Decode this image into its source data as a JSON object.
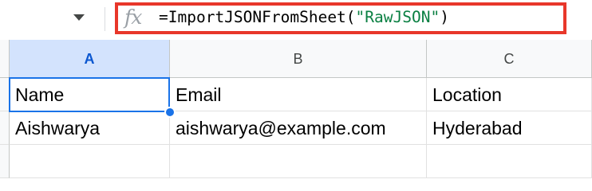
{
  "formula_bar": {
    "fx_label": "fx",
    "formula_prefix": "=ImportJSONFromSheet(",
    "formula_string": "\"RawJSON\"",
    "formula_suffix": ")"
  },
  "columns": [
    {
      "label": "A",
      "selected": true
    },
    {
      "label": "B",
      "selected": false
    },
    {
      "label": "C",
      "selected": false
    }
  ],
  "rows": [
    [
      "Name",
      "Email",
      "Location"
    ],
    [
      "Aishwarya",
      "aishwarya@example.com",
      "Hyderabad"
    ],
    [
      "",
      "",
      ""
    ]
  ],
  "colors": {
    "highlight_border": "#e8372a",
    "selection_blue": "#1a73e8",
    "string_green": "#0b8043"
  }
}
